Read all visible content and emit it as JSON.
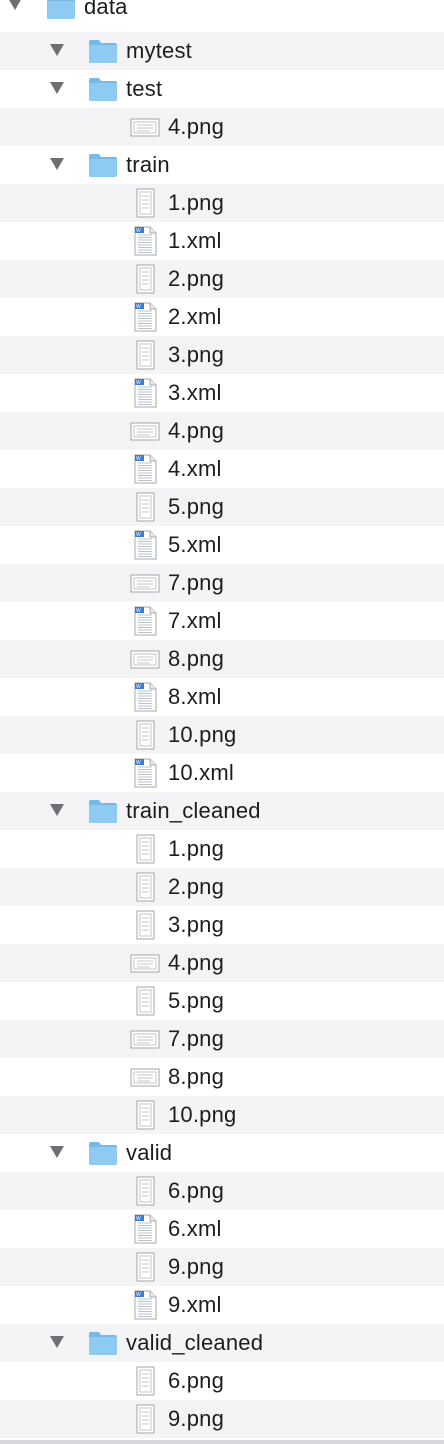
{
  "icons": {
    "folder": "folder-icon",
    "xml": "xml-document-icon",
    "image_portrait": "image-portrait-thumbnail-icon",
    "image_landscape": "image-landscape-thumbnail-icon",
    "disclosure": "disclosure-triangle-expanded"
  },
  "colors": {
    "folder_blue": "#8ecbf3",
    "folder_tab": "#7ab9e6",
    "stripe": "#f4f4f6",
    "triangle": "#6e6e73",
    "xml_badge": "#3a7bd5"
  },
  "rows": [
    {
      "label": "data",
      "kind": "folder",
      "level": 0,
      "expanded": true
    },
    {
      "label": "mytest",
      "kind": "folder",
      "level": 1,
      "expanded": true
    },
    {
      "label": "test",
      "kind": "folder",
      "level": 1,
      "expanded": true
    },
    {
      "label": "4.png",
      "kind": "image_landscape",
      "level": 2
    },
    {
      "label": "train",
      "kind": "folder",
      "level": 1,
      "expanded": true
    },
    {
      "label": "1.png",
      "kind": "image_portrait",
      "level": 2
    },
    {
      "label": "1.xml",
      "kind": "xml",
      "level": 2
    },
    {
      "label": "2.png",
      "kind": "image_portrait",
      "level": 2
    },
    {
      "label": "2.xml",
      "kind": "xml",
      "level": 2
    },
    {
      "label": "3.png",
      "kind": "image_portrait",
      "level": 2
    },
    {
      "label": "3.xml",
      "kind": "xml",
      "level": 2
    },
    {
      "label": "4.png",
      "kind": "image_landscape",
      "level": 2
    },
    {
      "label": "4.xml",
      "kind": "xml",
      "level": 2
    },
    {
      "label": "5.png",
      "kind": "image_portrait",
      "level": 2
    },
    {
      "label": "5.xml",
      "kind": "xml",
      "level": 2
    },
    {
      "label": "7.png",
      "kind": "image_landscape",
      "level": 2
    },
    {
      "label": "7.xml",
      "kind": "xml",
      "level": 2
    },
    {
      "label": "8.png",
      "kind": "image_landscape",
      "level": 2
    },
    {
      "label": "8.xml",
      "kind": "xml",
      "level": 2
    },
    {
      "label": "10.png",
      "kind": "image_portrait",
      "level": 2
    },
    {
      "label": "10.xml",
      "kind": "xml",
      "level": 2
    },
    {
      "label": "train_cleaned",
      "kind": "folder",
      "level": 1,
      "expanded": true
    },
    {
      "label": "1.png",
      "kind": "image_portrait",
      "level": 2
    },
    {
      "label": "2.png",
      "kind": "image_portrait",
      "level": 2
    },
    {
      "label": "3.png",
      "kind": "image_portrait",
      "level": 2
    },
    {
      "label": "4.png",
      "kind": "image_landscape",
      "level": 2
    },
    {
      "label": "5.png",
      "kind": "image_portrait",
      "level": 2
    },
    {
      "label": "7.png",
      "kind": "image_landscape",
      "level": 2
    },
    {
      "label": "8.png",
      "kind": "image_landscape",
      "level": 2
    },
    {
      "label": "10.png",
      "kind": "image_portrait",
      "level": 2
    },
    {
      "label": "valid",
      "kind": "folder",
      "level": 1,
      "expanded": true
    },
    {
      "label": "6.png",
      "kind": "image_portrait",
      "level": 2
    },
    {
      "label": "6.xml",
      "kind": "xml",
      "level": 2
    },
    {
      "label": "9.png",
      "kind": "image_portrait",
      "level": 2
    },
    {
      "label": "9.xml",
      "kind": "xml",
      "level": 2
    },
    {
      "label": "valid_cleaned",
      "kind": "folder",
      "level": 1,
      "expanded": true
    },
    {
      "label": "6.png",
      "kind": "image_portrait",
      "level": 2
    },
    {
      "label": "9.png",
      "kind": "image_portrait",
      "level": 2
    }
  ]
}
